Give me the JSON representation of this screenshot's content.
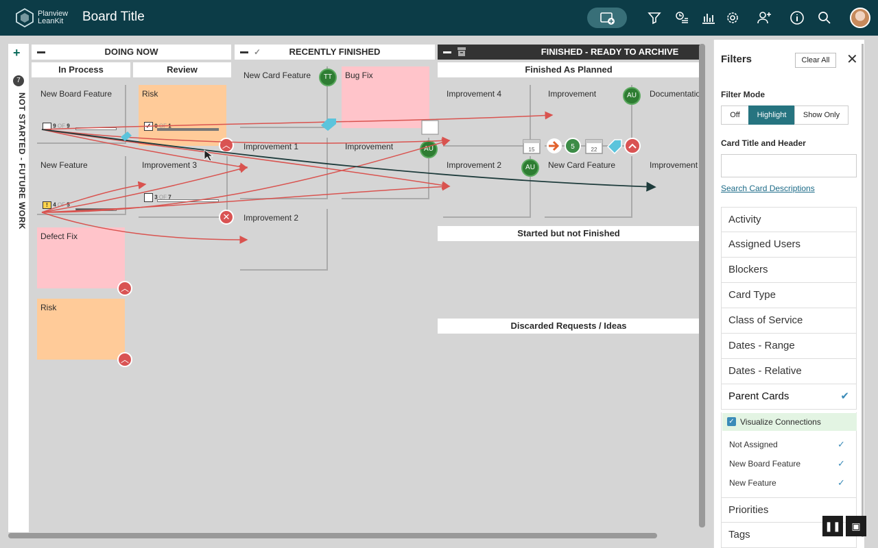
{
  "header": {
    "logo_line1": "Planview",
    "logo_line2": "LeanKit",
    "board_title": "Board Title"
  },
  "lanes": {
    "backlog_label": "NOT STARTED - FUTURE WORK",
    "backlog_count": "7",
    "doing_now": "DOING NOW",
    "in_process": "In Process",
    "review": "Review",
    "recently_finished": "RECENTLY FINISHED",
    "finished_archive": "FINISHED - READY TO ARCHIVE",
    "finished_as_planned": "Finished As Planned",
    "started_not_finished": "Started but not Finished",
    "discarded": "Discarded Requests / Ideas"
  },
  "cards": {
    "new_board_feature": "New Board Feature",
    "progress_9_done": "9",
    "progress_9_of": "OF",
    "progress_9_total": "9",
    "risk_1": "Risk",
    "progress_0_done": "0",
    "progress_0_of": "OF",
    "progress_0_total": "1",
    "new_feature": "New Feature",
    "progress_4_done": "4",
    "progress_4_of": "OF",
    "progress_4_total": "5",
    "improvement_3": "Improvement 3",
    "progress_3_done": "3",
    "progress_3_of": "OF",
    "progress_3_total": "7",
    "defect_fix": "Defect Fix",
    "risk_2": "Risk",
    "new_card_feature_1": "New Card Feature",
    "user_tt": "TT",
    "bug_fix": "Bug Fix",
    "improvement_1": "Improvement 1",
    "improvement_rf": "Improvement",
    "user_au_1": "AU",
    "improvement_2": "Improvement 2",
    "improvement_4": "Improvement 4",
    "improvement_fp": "Improvement",
    "user_au_2": "AU",
    "documentation": "Documentatio",
    "date_15": "15",
    "count_5": "5",
    "date_22": "22",
    "improvement_2b": "Improvement 2",
    "user_au_3": "AU",
    "new_card_feature_2": "New Card Feature",
    "improvement_fp2": "Improvement"
  },
  "filters": {
    "title": "Filters",
    "clear_all": "Clear All",
    "filter_mode_label": "Filter Mode",
    "mode_off": "Off",
    "mode_highlight": "Highlight",
    "mode_show_only": "Show Only",
    "card_title_label": "Card Title and Header",
    "search_link": "Search Card Descriptions",
    "items": [
      {
        "label": "Activity"
      },
      {
        "label": "Assigned Users"
      },
      {
        "label": "Blockers"
      },
      {
        "label": "Card Type"
      },
      {
        "label": "Class of Service"
      },
      {
        "label": "Dates - Range"
      },
      {
        "label": "Dates - Relative"
      },
      {
        "label": "Parent Cards"
      }
    ],
    "visualize_connections": "Visualize Connections",
    "parent_options": [
      {
        "label": "Not Assigned"
      },
      {
        "label": "New Board Feature"
      },
      {
        "label": "New Feature"
      }
    ],
    "more_items": [
      {
        "label": "Priorities"
      },
      {
        "label": "Tags"
      }
    ]
  },
  "colors": {
    "topbar": "#0c3c47",
    "accent": "#267480",
    "card_orange": "#ffcb99",
    "card_pink": "#ffc4ca",
    "connection_arrow": "#d9534f",
    "user_badge": "#2e7d32"
  }
}
